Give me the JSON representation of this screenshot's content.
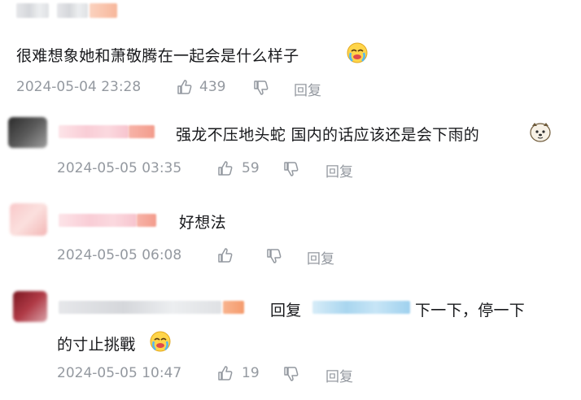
{
  "comments": [
    {
      "text": "很难想象她和萧敬腾在一起会是什么样子",
      "time": "2024-05-04 23:28",
      "likes": "439",
      "reply_label": "回复"
    },
    {
      "text": "强龙不压地头蛇 国内的话应该还是会下雨的",
      "time": "2024-05-05 03:35",
      "likes": "59",
      "reply_label": "回复"
    },
    {
      "text": "好想法",
      "time": "2024-05-05 06:08",
      "likes": "",
      "reply_label": "回复"
    },
    {
      "reply_prefix": "回复",
      "text_line1": "下一下，停一下",
      "text_line2": "的寸止挑戰",
      "time": "2024-05-05 10:47",
      "likes": "19",
      "reply_label": "回复"
    }
  ],
  "icons": {
    "like": "thumbs-up-icon",
    "dislike": "thumbs-down-icon",
    "emoji_cry": "crying-emoji-icon",
    "emoji_dog": "dog-emoji-icon"
  },
  "colors": {
    "text": "#18191c",
    "meta": "#9499a0"
  }
}
